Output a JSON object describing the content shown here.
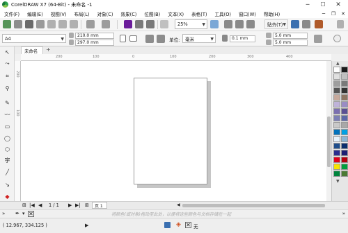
{
  "window": {
    "title": "CorelDRAW X7 (64-Bit) - 未命名 -1",
    "controls": {
      "minimize": "─",
      "maximize": "☐",
      "close": "✕"
    }
  },
  "menu": {
    "items": [
      "文件(F)",
      "编辑(E)",
      "视图(V)",
      "布局(L)",
      "对象(C)",
      "效果(C)",
      "位图(B)",
      "文本(X)",
      "表格(T)",
      "工具(O)",
      "窗口(W)",
      "帮助(H)"
    ],
    "right_controls": [
      "─",
      "❐",
      "✕"
    ]
  },
  "toolbar": {
    "zoom": "25%",
    "paste_label": "贴齐(T)"
  },
  "property_bar": {
    "paper_size": "A4",
    "width": "210.0 mm",
    "height": "297.0 mm",
    "units_label": "单位:",
    "units_value": "毫米",
    "nudge": "0.1 mm",
    "dup_x": "5.0 mm",
    "dup_y": "5.0 mm"
  },
  "document_tab": {
    "label": "未命名 -1",
    "add": "+"
  },
  "rulers": {
    "h_ticks": [
      "200",
      "100",
      "0",
      "100",
      "200",
      "300",
      "400"
    ],
    "v_ticks": [
      "200",
      "100"
    ]
  },
  "page_nav": {
    "page_counter": "1 / 1",
    "page_tab": "页 1"
  },
  "status": {
    "hint": "将颜色(或对象)拖动至此处，以便将这些颜色与文档存储在一起",
    "coords": "( 12.967, 334.125 )",
    "fill_none": "无"
  },
  "palette_colors": [
    "#ffffff",
    "#1a1a1a",
    "#e0e0e0",
    "#c0c0c0",
    "#9e9e9e",
    "#7a7a7a",
    "#555555",
    "#333333",
    "#c6a99c",
    "#8e7563",
    "#bfb3d9",
    "#9a8cc4",
    "#7b6fb0",
    "#5b4f93",
    "#7c7fb5",
    "#5d68a8",
    "#c9c9c9",
    "#a8a8a8",
    "#0072bc",
    "#00a0e3",
    "#e5f2fb",
    "#8ab5d5",
    "#1f4e8c",
    "#0b2e6e",
    "#2b2d8e",
    "#1c1e74",
    "#e2001a",
    "#b5000f",
    "#f7e300",
    "#009f3d",
    "#00843d",
    "#4b7a34"
  ]
}
